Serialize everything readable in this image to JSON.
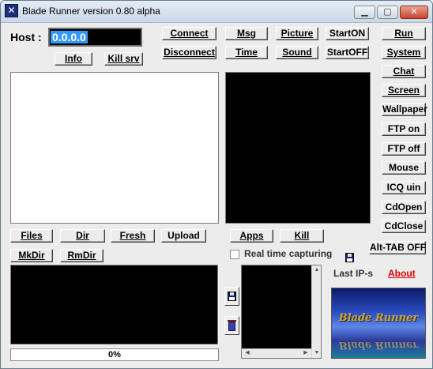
{
  "window": {
    "title": "Blade Runner version 0.80 alpha",
    "app_icon_glyph": "✕",
    "minimize_glyph": "▁",
    "maximize_glyph": "▢",
    "close_glyph": "✕"
  },
  "connection": {
    "host_label": "Host :",
    "host_value": "0.0.0.0"
  },
  "buttons": {
    "info": "Info",
    "kill_srv": "Kill srv",
    "connect": "Connect",
    "disconnect": "Disconnect",
    "msg": "Msg",
    "time": "Time",
    "picture": "Picture",
    "sound": "Sound",
    "start_on": "StartON",
    "start_off": "StartOFF",
    "run": "Run",
    "system": "System",
    "chat": "Chat",
    "screen": "Screen",
    "wallpaper": "Wallpaper",
    "ftp_on": "FTP on",
    "ftp_off": "FTP off",
    "mouse": "Mouse",
    "icq_uin": "ICQ uin",
    "cd_open": "CdOpen",
    "cd_close": "CdClose",
    "alt_tab_off": "Alt-TAB OFF",
    "files": "Files",
    "dir": "Dir",
    "fresh": "Fresh",
    "upload": "Upload",
    "mkdir": "MkDir",
    "rmdir": "RmDir",
    "apps": "Apps",
    "kill": "Kill"
  },
  "capture": {
    "realtime_label": "Real time capturing",
    "realtime_checked": false
  },
  "footer": {
    "last_ips_label": "Last  IP-s",
    "about_label": "About",
    "progress_text": "0%",
    "progress_value": 0
  },
  "logo": {
    "text": "Blade Runner",
    "reflection": "Blade Runner"
  },
  "colors": {
    "about_link": "#e00000",
    "host_highlight": "#3399ff"
  }
}
